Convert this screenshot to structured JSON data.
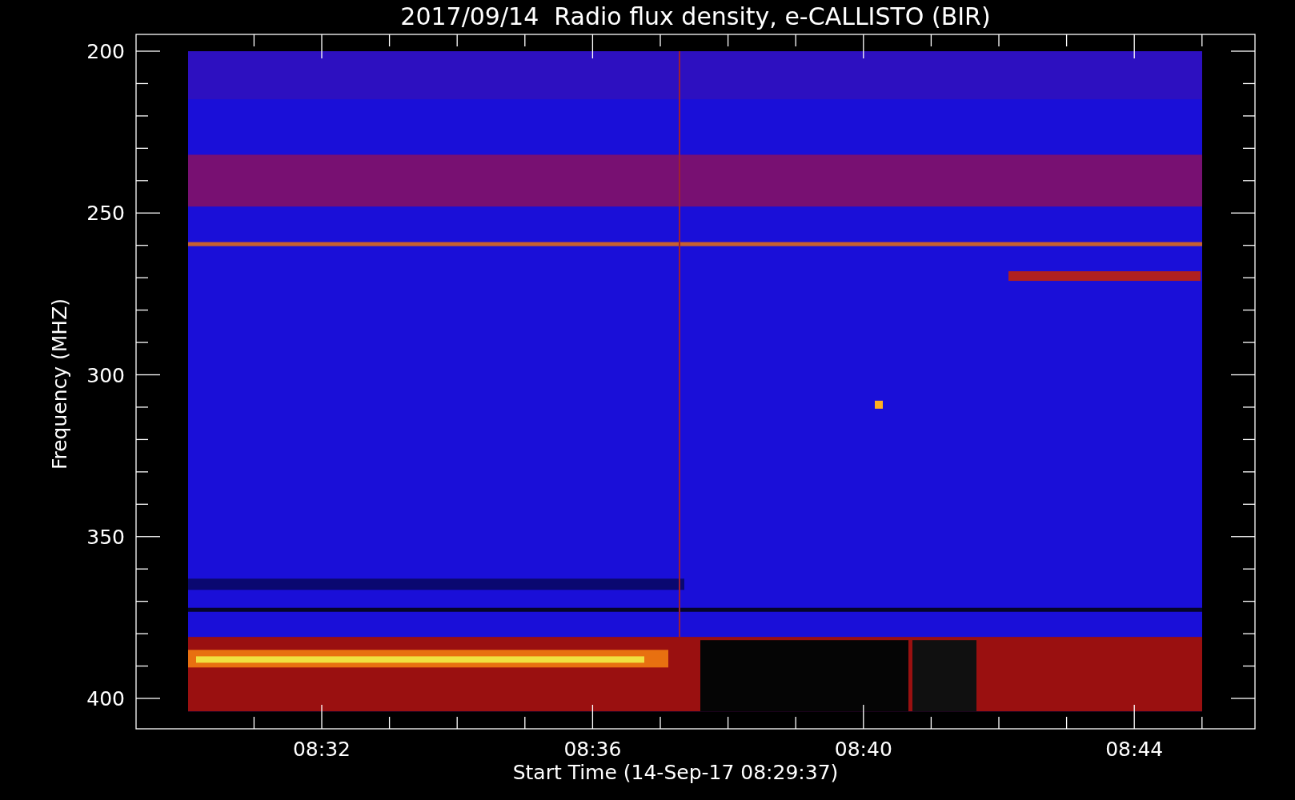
{
  "plot": {
    "title": "2017/09/14  Radio flux density, e-CALLISTO (BIR)",
    "y_axis": {
      "label": "Frequency (MHZ)",
      "ticks": [
        "200",
        "250",
        "300",
        "350",
        "400"
      ]
    },
    "x_axis": {
      "label": "Start Time (14-Sep-17 08:29:37)",
      "ticks": [
        "08:32",
        "08:36",
        "08:40",
        "08:44"
      ]
    }
  }
}
